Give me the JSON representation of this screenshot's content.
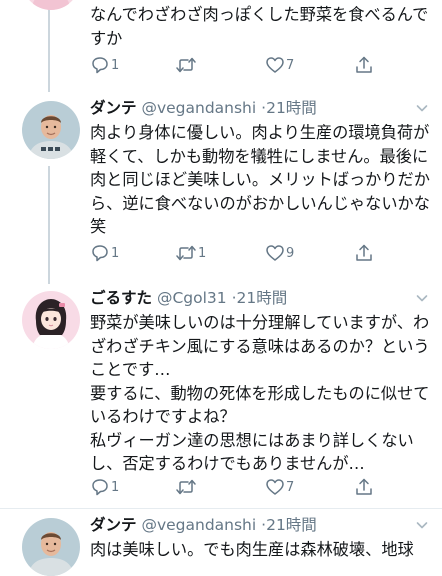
{
  "tweet0": {
    "text": "なんでわざわざ肉っぽくした野菜を食べるんですか",
    "replies": "1",
    "retweets": "",
    "likes": "7"
  },
  "tweet1": {
    "name": "ダンテ",
    "handle": "@vegandanshi",
    "separator": "·",
    "time": "21時間",
    "text": "肉より身体に優しい。肉より生産の環境負荷が軽くて、しかも動物を犠牲にしません。最後に肉と同じほど美味しい。メリットばっかりだから、逆に食べないのがおかしいんじゃないかな　笑",
    "replies": "1",
    "retweets": "1",
    "likes": "9"
  },
  "tweet2": {
    "name": "ごるすた",
    "handle": "@Cgol31",
    "separator": "·",
    "time": "21時間",
    "paragraphs": [
      "野菜が美味しいのは十分理解していますが、わざわざチキン風にする意味はあるのか？ということです…",
      "要するに、動物の死体を形成したものに似せているわけですよね？",
      "私ヴィーガン達の思想にはあまり詳しくないし、否定するわけでもありませんが…"
    ],
    "replies": "1",
    "retweets": "",
    "likes": "7"
  },
  "tweet3": {
    "name": "ダンテ",
    "handle": "@vegandanshi",
    "separator": "·",
    "time": "21時間",
    "text": "肉は美味しい。でも肉生産は森林破壊、地球"
  },
  "colors": {
    "text": "#14171a",
    "secondary": "#657786",
    "thread_line": "#ccd6dd",
    "divider": "#e6ecf0"
  },
  "icons": [
    "reply-icon",
    "retweet-icon",
    "like-icon",
    "share-icon",
    "caret-down-icon"
  ]
}
